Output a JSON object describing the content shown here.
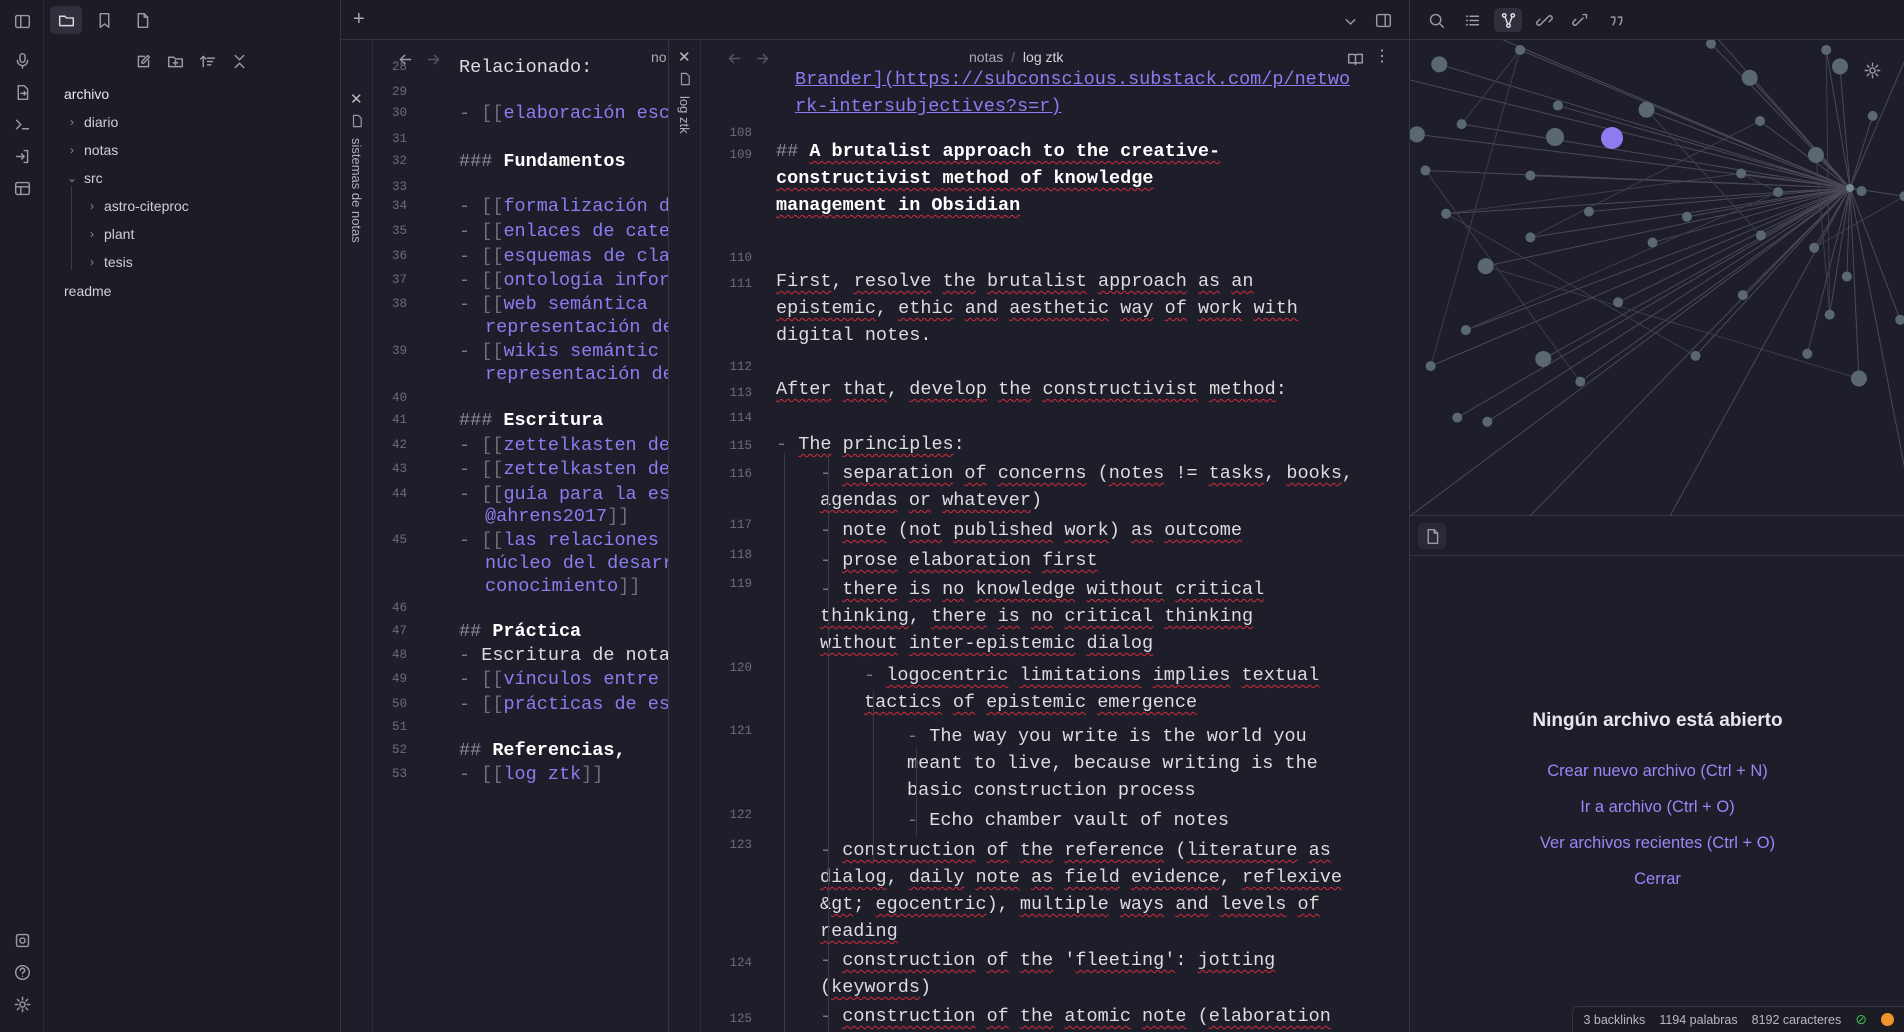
{
  "ribbon": {
    "icons": [
      "sidebar-toggle-icon",
      "mic-icon",
      "file-swap-icon",
      "terminal-icon",
      "login-icon",
      "layout-icon",
      "vault-icon",
      "help-icon",
      "gear-icon"
    ]
  },
  "sidebar": {
    "tabs": [
      "folder-icon",
      "bookmark-icon",
      "file-icon"
    ],
    "actions": [
      "new-note-icon",
      "new-folder-icon",
      "sort-icon",
      "collapse-icon"
    ],
    "vault_name": "archivo",
    "tree": [
      {
        "label": "diario",
        "depth": 0,
        "folder": true,
        "open": false
      },
      {
        "label": "notas",
        "depth": 0,
        "folder": true,
        "open": false
      },
      {
        "label": "src",
        "depth": 0,
        "folder": true,
        "open": true
      },
      {
        "label": "astro-citeproc",
        "depth": 1,
        "folder": true,
        "open": false
      },
      {
        "label": "plant",
        "depth": 1,
        "folder": true,
        "open": false
      },
      {
        "label": "tesis",
        "depth": 1,
        "folder": true,
        "open": false
      },
      {
        "label": "readme",
        "depth": 0,
        "folder": false,
        "open": false
      }
    ]
  },
  "tabbar": {
    "new_tab": "+"
  },
  "pane1": {
    "vertical_tab": "sistemas de notas",
    "title_fragment": "no",
    "lines": [
      {
        "n": "28",
        "t": "Relacionado:"
      },
      {
        "n": "29",
        "t": ""
      },
      {
        "n": "30",
        "t": "- [[elaboración esc"
      },
      {
        "n": "31",
        "t": ""
      },
      {
        "n": "32",
        "t": "### Fundamentos"
      },
      {
        "n": "33",
        "t": ""
      },
      {
        "n": "34",
        "t": "- [[formalización d"
      },
      {
        "n": "35",
        "t": "- [[enlaces de cate"
      },
      {
        "n": "36",
        "t": "- [[esquemas de cla"
      },
      {
        "n": "37",
        "t": "- [[ontología infor"
      },
      {
        "n": "38",
        "t": "- [[web semántica"
      },
      {
        "n": "38b",
        "t": "representación de"
      },
      {
        "n": "39",
        "t": "- [[wikis semántic"
      },
      {
        "n": "39b",
        "t": "representación de"
      },
      {
        "n": "40",
        "t": ""
      },
      {
        "n": "41",
        "t": "### Escritura"
      },
      {
        "n": "42",
        "t": "- [[zettelkasten de"
      },
      {
        "n": "43",
        "t": "- [[zettelkasten de"
      },
      {
        "n": "44",
        "t": "- [[guía para la es"
      },
      {
        "n": "44b",
        "t": "@ahrens2017]]"
      },
      {
        "n": "45",
        "t": "- [[las relaciones"
      },
      {
        "n": "45b",
        "t": "núcleo del desarr"
      },
      {
        "n": "45c",
        "t": "conocimiento]]"
      },
      {
        "n": "46",
        "t": ""
      },
      {
        "n": "47",
        "t": "## Práctica"
      },
      {
        "n": "48",
        "t": "- Escritura de nota"
      },
      {
        "n": "49",
        "t": "- [[vínculos entre"
      },
      {
        "n": "50",
        "t": "- [[prácticas de es"
      },
      {
        "n": "51",
        "t": ""
      },
      {
        "n": "52",
        "t": "## Referencias,"
      },
      {
        "n": "53",
        "t": "- [[log ztk]]"
      }
    ]
  },
  "pane2": {
    "vertical_tab": "log ztk",
    "breadcrumb": [
      "notas",
      "log ztk"
    ],
    "link_line_1": "Brander](https://subconscious.substack.com/p/netwo",
    "link_line_2": "rk-intersubjectives?s=r)",
    "heading": [
      "## A brutalist approach to the creative-",
      "constructivist method of knowledge",
      "management in Obsidian"
    ],
    "p111": [
      "First, resolve the brutalist approach as an",
      "epistemic, ethic and aesthetic way of work with",
      "digital notes."
    ],
    "p113": "After that, develop the constructivist method:",
    "b115": "The principles:",
    "b116": [
      "separation of concerns (notes != tasks, books,",
      "agendas or whatever)"
    ],
    "b117": "note (not published work) as outcome",
    "b118": "prose elaboration first",
    "b119": [
      "there is no knowledge without critical",
      "thinking, there is no critical thinking",
      "without inter-epistemic dialog"
    ],
    "b120": [
      "logocentric limitations implies textual",
      "tactics of epistemic emergence"
    ],
    "b121": [
      "The way you write is the world you",
      "meant to live, because writing is the",
      "basic construction process"
    ],
    "b122": "Echo chamber vault of notes",
    "b123": [
      "construction of the reference (literature as",
      "dialog, daily note as field evidence, reflexive",
      "> egocentric), multiple ways and levels of",
      "reading"
    ],
    "b124": [
      "construction of the 'fleeting': jotting",
      "(keywords)"
    ],
    "b125": "construction of the atomic note (elaboration",
    "line_numbers": [
      "108",
      "109",
      "110",
      "111",
      "112",
      "113",
      "114",
      "115",
      "116",
      "117",
      "118",
      "119",
      "120",
      "121",
      "122",
      "123",
      "124",
      "125"
    ]
  },
  "right": {
    "top_icons": [
      "search-icon",
      "outline-icon",
      "graph-icon",
      "backlinks-icon",
      "outgoing-links-icon",
      "quote-icon"
    ],
    "empty_title": "Ningún archivo está abierto",
    "empty_links": [
      "Crear nuevo archivo (Ctrl + N)",
      "Ir a archivo (Ctrl + O)",
      "Ver archivos recientes (Ctrl + O)",
      "Cerrar"
    ]
  },
  "status": {
    "backlinks": "3 backlinks",
    "words": "1194 palabras",
    "chars": "8192 caracteres"
  },
  "colors": {
    "accent": "#8c7cf0",
    "bg": "#1e1e2a",
    "panel": "#1c1c24",
    "spell": "#d22a3a",
    "sync": "#f0922e",
    "ok": "#3fb950"
  }
}
